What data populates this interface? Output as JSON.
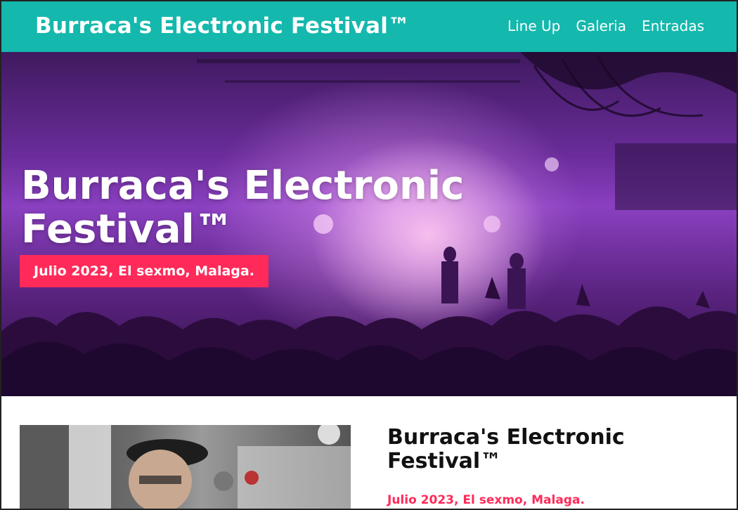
{
  "header": {
    "brand": "Burraca's Electronic Festival™",
    "nav": [
      "Line Up",
      "Galeria",
      "Entradas"
    ]
  },
  "hero": {
    "title": "Burraca's Electronic Festival™",
    "badge": "Julio 2023, El sexmo, Malaga."
  },
  "info": {
    "title": "Burraca's Electronic Festival™",
    "date": "Julio 2023, El sexmo, Malaga."
  },
  "colors": {
    "header_bg": "#14b8ad",
    "accent": "#ff2a59"
  }
}
